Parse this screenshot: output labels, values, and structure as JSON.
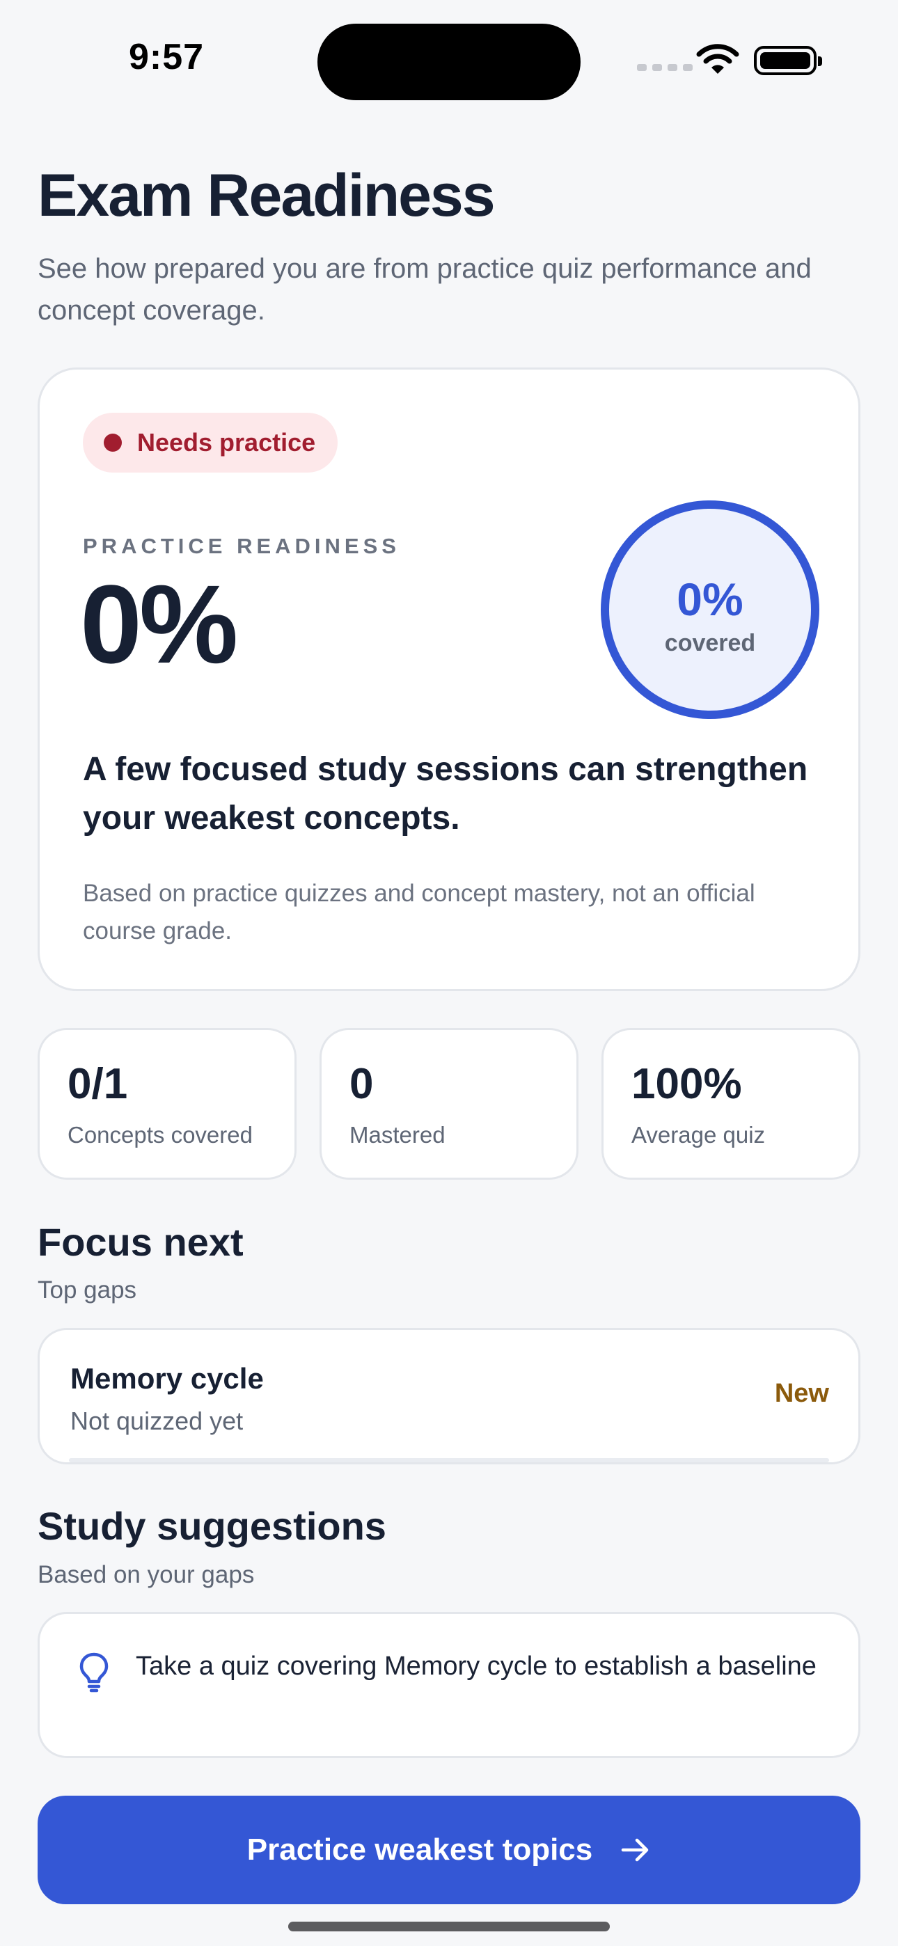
{
  "status_bar": {
    "time": "9:57"
  },
  "header": {
    "title": "Exam Readiness",
    "subtitle": "See how prepared you are from practice quiz performance and concept coverage."
  },
  "readiness": {
    "badge": "Needs practice",
    "label": "PRACTICE READINESS",
    "value": "0%",
    "coverage_value": "0%",
    "coverage_label": "covered",
    "coverage_fraction": 0,
    "message": "A few focused study sessions can strengthen your weakest concepts.",
    "note": "Based on practice quizzes and concept mastery, not an official course grade."
  },
  "stats": [
    {
      "value": "0/1",
      "label": "Concepts covered"
    },
    {
      "value": "0",
      "label": "Mastered"
    },
    {
      "value": "100%",
      "label": "Average quiz"
    }
  ],
  "focus": {
    "title": "Focus next",
    "subtitle": "Top gaps",
    "items": [
      {
        "name": "Memory cycle",
        "status": "Not quizzed yet",
        "tag": "New",
        "mastery": 0
      }
    ]
  },
  "suggestions": {
    "title": "Study suggestions",
    "subtitle": "Based on your gaps",
    "items": [
      {
        "text": "Take a quiz covering Memory cycle to establish a baseline",
        "icon": "lightbulb-icon"
      }
    ]
  },
  "cta": {
    "label": "Practice weakest topics",
    "icon": "arrow-right-icon"
  },
  "colors": {
    "accent": "#3457d5",
    "danger": "#a11d2f",
    "danger_bg": "#fde8ea",
    "warning": "#8b5a0b",
    "background": "#f6f7f9"
  }
}
